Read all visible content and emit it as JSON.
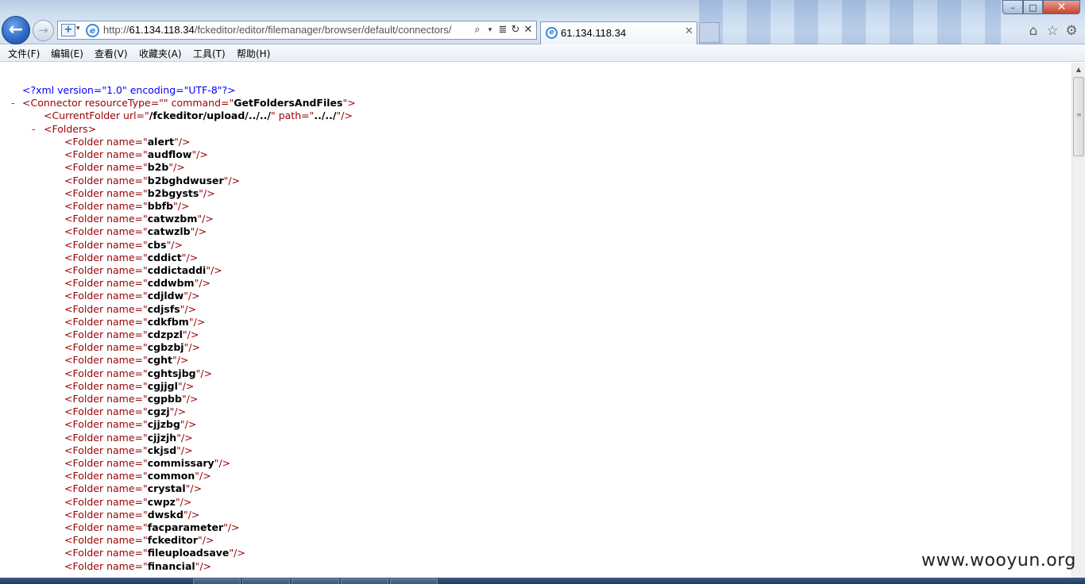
{
  "browser": {
    "url_prefix": "http://",
    "url_host": "61.134.118.34",
    "url_path": "/fckeditor/editor/filemanager/browser/default/connectors/",
    "tab_title": "61.134.118.34",
    "back_icon": "back-arrow-icon",
    "forward_icon": "forward-arrow-icon"
  },
  "menu": {
    "items": [
      "文件(F)",
      "编辑(E)",
      "查看(V)",
      "收藏夹(A)",
      "工具(T)",
      "帮助(H)"
    ]
  },
  "xml": {
    "declaration": "<?xml version=\"1.0\" encoding=\"UTF-8\"?>",
    "connector_open_prefix": "<Connector resourceType=\"\" command=\"",
    "connector_command": "GetFoldersAndFiles",
    "connector_open_suffix": "\">",
    "current_folder_prefix": "<CurrentFolder url=\"",
    "current_folder_url": "/fckeditor/upload/../../",
    "current_folder_mid": "\" path=\"",
    "current_folder_path": "../../",
    "current_folder_suffix": "\"/>",
    "folders_open": "<Folders>",
    "folder_prefix": "<Folder name=\"",
    "folder_suffix": "\"/>",
    "folders": [
      "alert",
      "audflow",
      "b2b",
      "b2bghdwuser",
      "b2bgysts",
      "bbfb",
      "catwzbm",
      "catwzlb",
      "cbs",
      "cddict",
      "cddictaddi",
      "cddwbm",
      "cdjldw",
      "cdjsfs",
      "cdkfbm",
      "cdzpzl",
      "cgbzbj",
      "cght",
      "cghtsjbg",
      "cgjjgl",
      "cgpbb",
      "cgzj",
      "cjjzbg",
      "cjjzjh",
      "ckjsd",
      "commissary",
      "common",
      "crystal",
      "cwpz",
      "dwskd",
      "facparameter",
      "fckeditor",
      "fileuploadsave",
      "financial"
    ],
    "minus_sign": "-"
  },
  "watermark": "www.wooyun.org"
}
